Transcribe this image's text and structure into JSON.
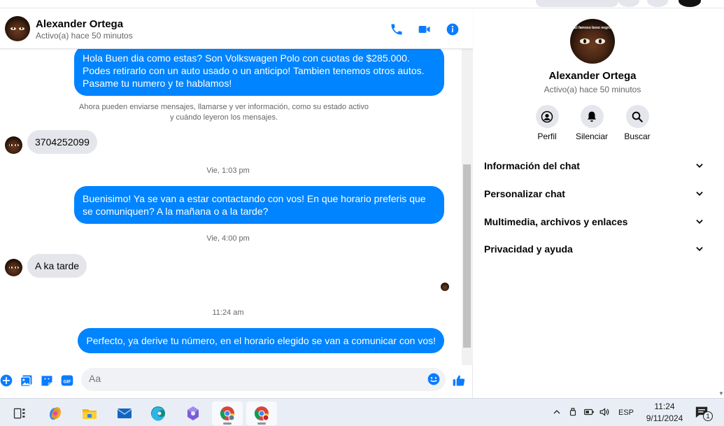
{
  "contact": {
    "name": "Alexander Ortega",
    "status": "Activo(a) hace 50 minutos",
    "avatar_caption": "El famoso beso negro"
  },
  "header_icons": [
    "phone-icon",
    "video-icon",
    "info-icon"
  ],
  "messages": {
    "m1": "Hola Buen dia como estas?  Son Volkswagen Polo con cuotas de $285.000. Podes retirarlo con un auto usado o un anticipo! Tambien tenemos otros autos. Pasame tu numero y te hablamos!",
    "sys1": "Ahora pueden enviarse mensajes, llamarse y ver información, como su estado activo",
    "sys2": "y cuándo leyeron los mensajes.",
    "m2": "3704252099",
    "ts1": "Vie, 1:03 pm",
    "m3": "Buenisimo! Ya se van a estar contactando con vos! En que horario preferis que se comuniquen? A la mañana o a la tarde?",
    "ts2": "Vie, 4:00 pm",
    "m4": "A ka tarde",
    "ts3": "11:24 am",
    "m5": "Perfecto, ya derive tu número, en el horario elegido se van a comunicar con vos!"
  },
  "composer": {
    "placeholder": "Aa"
  },
  "info_panel": {
    "actions": {
      "profile": "Perfil",
      "mute": "Silenciar",
      "search": "Buscar"
    },
    "sections": {
      "chat_info": "Información del chat",
      "customize": "Personalizar chat",
      "media": "Multimedia, archivos y enlaces",
      "privacy": "Privacidad y ayuda"
    }
  },
  "taskbar": {
    "language": "ESP",
    "time": "11:24",
    "date": "9/11/2024",
    "notification_count": "1"
  },
  "colors": {
    "messenger_blue": "#0084ff",
    "incoming_bubble": "#e4e6eb",
    "header_icon": "#0a7cff"
  }
}
